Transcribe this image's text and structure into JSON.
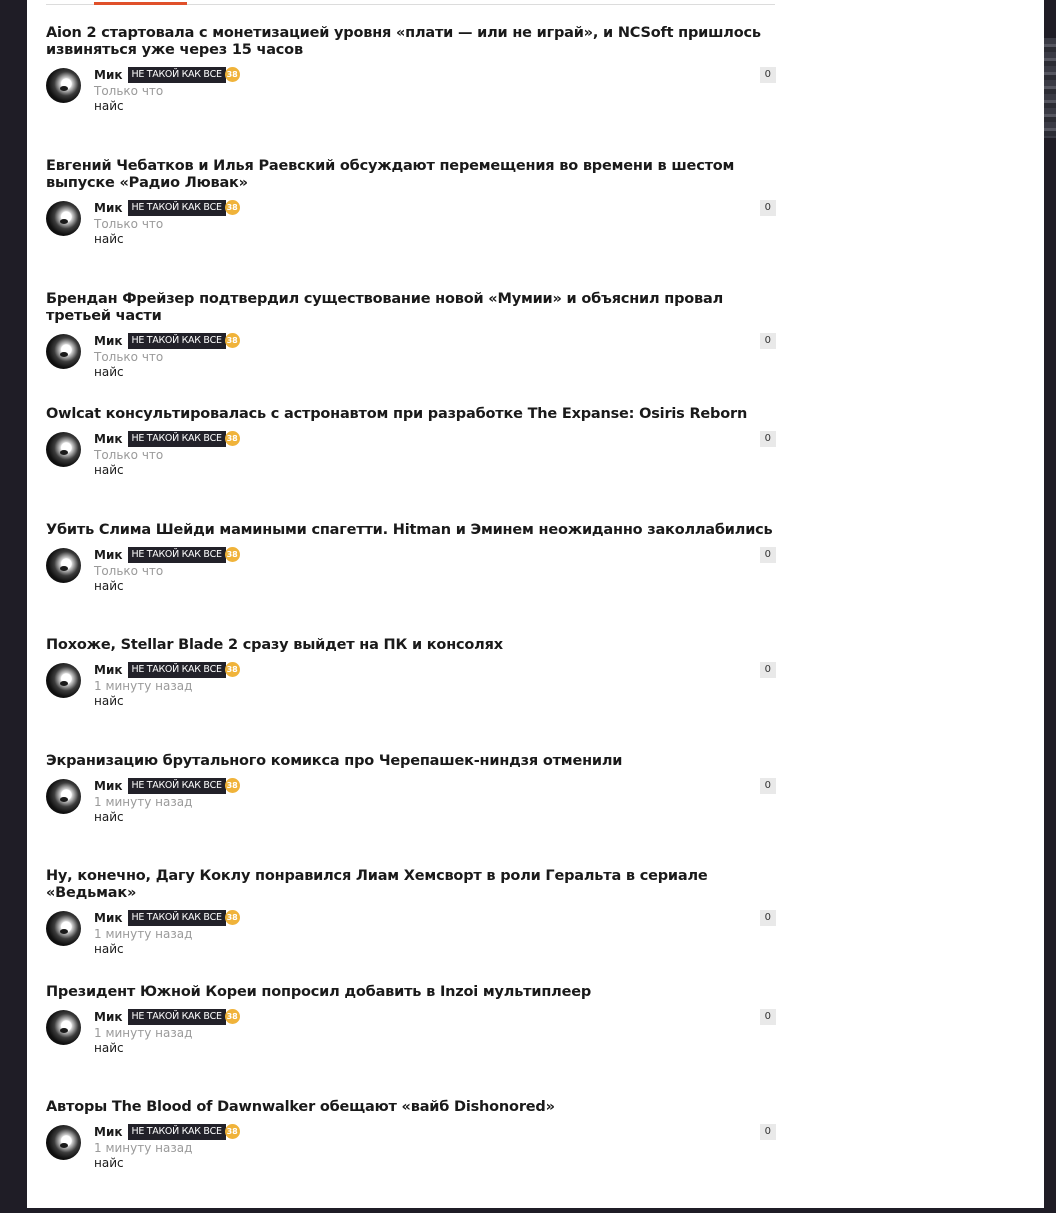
{
  "comments": [
    {
      "headline": "Aion 2 стартовала с монетизацией уровня «плати — или не играй», и NCSoft пришлось извиняться уже через 15 часов",
      "author": "Мик",
      "badge": "НЕ ТАКОЙ КАК ВСЕ",
      "level": "38",
      "time": "Только что",
      "text": "найс",
      "score": "0"
    },
    {
      "headline": "Евгений Чебатков и Илья Раевский обсуждают перемещения во времени в шестом выпуске «Радио Лювак»",
      "author": "Мик",
      "badge": "НЕ ТАКОЙ КАК ВСЕ",
      "level": "38",
      "time": "Только что",
      "text": "найс",
      "score": "0"
    },
    {
      "headline": "Брендан Фрейзер подтвердил существование новой «Мумии» и объяснил провал третьей части",
      "author": "Мик",
      "badge": "НЕ ТАКОЙ КАК ВСЕ",
      "level": "38",
      "time": "Только что",
      "text": "найс",
      "score": "0"
    },
    {
      "headline": "Owlcat консультировалась с астронавтом при разработке The Expanse: Osiris Reborn",
      "author": "Мик",
      "badge": "НЕ ТАКОЙ КАК ВСЕ",
      "level": "38",
      "time": "Только что",
      "text": "найс",
      "score": "0"
    },
    {
      "headline": "Убить Слима Шейди мамиными спагетти. Hitman и Эминем неожиданно заколлабились",
      "author": "Мик",
      "badge": "НЕ ТАКОЙ КАК ВСЕ",
      "level": "38",
      "time": "Только что",
      "text": "найс",
      "score": "0"
    },
    {
      "headline": "Похоже, Stellar Blade 2 сразу выйдет на ПК и консолях",
      "author": "Мик",
      "badge": "НЕ ТАКОЙ КАК ВСЕ",
      "level": "38",
      "time": "1 минуту назад",
      "text": "найс",
      "score": "0"
    },
    {
      "headline": "Экранизацию брутального комикса про Черепашек-ниндзя отменили",
      "author": "Мик",
      "badge": "НЕ ТАКОЙ КАК ВСЕ",
      "level": "38",
      "time": "1 минуту назад",
      "text": "найс",
      "score": "0"
    },
    {
      "headline": "Ну, конечно, Дагу Коклу понравился Лиам Хемсворт в роли Геральта в сериале «Ведьмак»",
      "author": "Мик",
      "badge": "НЕ ТАКОЙ КАК ВСЕ",
      "level": "38",
      "time": "1 минуту назад",
      "text": "найс",
      "score": "0"
    },
    {
      "headline": "Президент Южной Кореи попросил добавить в Inzoi мультиплеер",
      "author": "Мик",
      "badge": "НЕ ТАКОЙ КАК ВСЕ",
      "level": "38",
      "time": "1 минуту назад",
      "text": "найс",
      "score": "0"
    },
    {
      "headline": "Авторы The Blood of Dawnwalker обещают «вайб Dishonored»",
      "author": "Мик",
      "badge": "НЕ ТАКОЙ КАК ВСЕ",
      "level": "38",
      "time": "1 минуту назад",
      "text": "найс",
      "score": "0"
    }
  ]
}
